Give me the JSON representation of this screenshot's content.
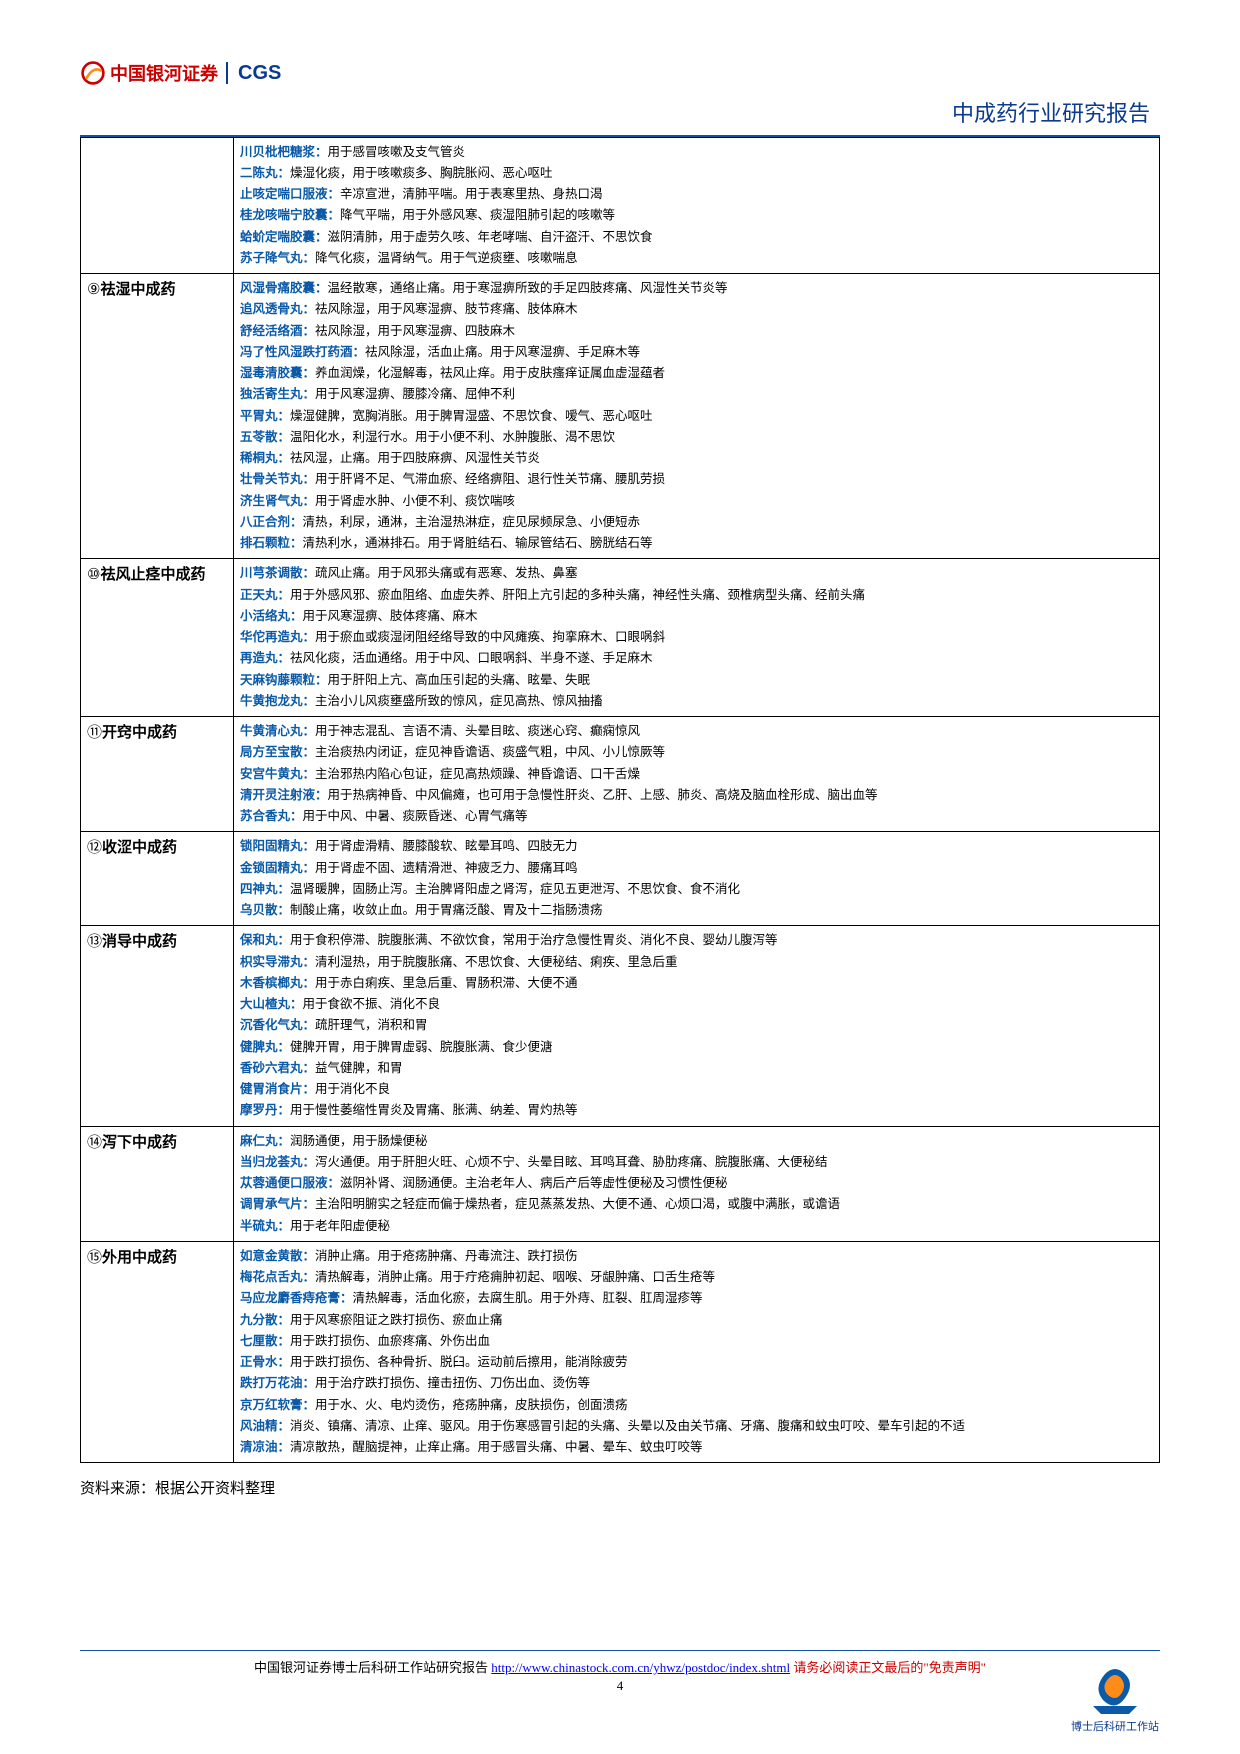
{
  "header": {
    "logo_cn": "中国银河证券",
    "logo_en": "CGS",
    "report_title": "中成药行业研究报告"
  },
  "sections": [
    {
      "id": "s0",
      "cat_circ": "",
      "cat_name": "",
      "show_cat": false,
      "items": [
        {
          "name": "川贝枇杷糖浆：",
          "desc": "用于感冒咳嗽及支气管炎"
        },
        {
          "name": "二陈丸：",
          "desc": "燥湿化痰，用于咳嗽痰多、胸脘胀闷、恶心呕吐"
        },
        {
          "name": "止咳定喘口服液：",
          "desc": "辛凉宣泄，清肺平喘。用于表寒里热、身热口渴"
        },
        {
          "name": "桂龙咳喘宁胶囊：",
          "desc": "降气平喘，用于外感风寒、痰湿阻肺引起的咳嗽等"
        },
        {
          "name": "蛤蚧定喘胶囊：",
          "desc": "滋阴清肺，用于虚劳久咳、年老哮喘、自汗盗汗、不思饮食"
        },
        {
          "name": "苏子降气丸：",
          "desc": "降气化痰，温肾纳气。用于气逆痰壅、咳嗽喘息"
        }
      ]
    },
    {
      "id": "s9",
      "cat_circ": "⑨",
      "cat_name": "祛湿中成药",
      "show_cat": true,
      "items": [
        {
          "name": "风湿骨痛胶囊：",
          "desc": "温经散寒，通络止痛。用于寒湿痹所致的手足四肢疼痛、风湿性关节炎等"
        },
        {
          "name": "追风透骨丸：",
          "desc": "祛风除湿，用于风寒湿痹、肢节疼痛、肢体麻木"
        },
        {
          "name": "舒经活络酒：",
          "desc": "祛风除湿，用于风寒湿痹、四肢麻木"
        },
        {
          "name": "冯了性风湿跌打药酒：",
          "desc": "祛风除湿，活血止痛。用于风寒湿痹、手足麻木等"
        },
        {
          "name": "湿毒清胶囊：",
          "desc": "养血润燥，化湿解毒，祛风止痒。用于皮肤瘙痒证属血虚湿蕴者"
        },
        {
          "name": "独活寄生丸：",
          "desc": "用于风寒湿痹、腰膝冷痛、屈伸不利"
        },
        {
          "name": "平胃丸：",
          "desc": "燥湿健脾，宽胸消胀。用于脾胃湿盛、不思饮食、嗳气、恶心呕吐"
        },
        {
          "name": "五苓散：",
          "desc": "温阳化水，利湿行水。用于小便不利、水肿腹胀、渴不思饮"
        },
        {
          "name": "稀桐丸：",
          "desc": "祛风湿，止痛。用于四肢麻痹、风湿性关节炎"
        },
        {
          "name": "壮骨关节丸：",
          "desc": "用于肝肾不足、气滞血瘀、经络痹阻、退行性关节痛、腰肌劳损"
        },
        {
          "name": "济生肾气丸：",
          "desc": "用于肾虚水肿、小便不利、痰饮喘咳"
        },
        {
          "name": "八正合剂：",
          "desc": "清热，利尿，通淋，主治湿热淋症，症见尿频尿急、小便短赤"
        },
        {
          "name": "排石颗粒：",
          "desc": "清热利水，通淋排石。用于肾脏结石、输尿管结石、膀胱结石等"
        }
      ]
    },
    {
      "id": "s10",
      "cat_circ": "⑩",
      "cat_name": "祛风止痉中成药",
      "show_cat": true,
      "items": [
        {
          "name": "川芎茶调散：",
          "desc": "疏风止痛。用于风邪头痛或有恶寒、发热、鼻塞"
        },
        {
          "name": "正天丸：",
          "desc": "用于外感风邪、瘀血阻络、血虚失养、肝阳上亢引起的多种头痛，神经性头痛、颈椎病型头痛、经前头痛"
        },
        {
          "name": "小活络丸：",
          "desc": "用于风寒湿痹、肢体疼痛、麻木"
        },
        {
          "name": "华佗再造丸：",
          "desc": "用于瘀血或痰湿闭阻经络导致的中风瘫痪、拘挛麻木、口眼㖞斜"
        },
        {
          "name": "再造丸：",
          "desc": "祛风化痰，活血通络。用于中风、口眼㖞斜、半身不遂、手足麻木"
        },
        {
          "name": "天麻钩藤颗粒：",
          "desc": "用于肝阳上亢、高血压引起的头痛、眩晕、失眠"
        },
        {
          "name": "牛黄抱龙丸：",
          "desc": "主治小儿风痰壅盛所致的惊风，症见高热、惊风抽搐"
        }
      ]
    },
    {
      "id": "s11",
      "cat_circ": "⑪",
      "cat_name": "开窍中成药",
      "show_cat": true,
      "items": [
        {
          "name": "牛黄清心丸：",
          "desc": "用于神志混乱、言语不清、头晕目眩、痰迷心窍、癫痫惊风"
        },
        {
          "name": "局方至宝散：",
          "desc": "主治痰热内闭证，症见神昏谵语、痰盛气粗，中风、小儿惊厥等"
        },
        {
          "name": "安宫牛黄丸：",
          "desc": "主治邪热内陷心包证，症见高热烦躁、神昏谵语、口干舌燥"
        },
        {
          "name": "清开灵注射液：",
          "desc": "用于热病神昏、中风偏瘫，也可用于急慢性肝炎、乙肝、上感、肺炎、高烧及脑血栓形成、脑出血等"
        },
        {
          "name": "苏合香丸：",
          "desc": "用于中风、中暑、痰厥昏迷、心胃气痛等"
        }
      ]
    },
    {
      "id": "s12",
      "cat_circ": "⑫",
      "cat_name": "收涩中成药",
      "show_cat": true,
      "items": [
        {
          "name": "锁阳固精丸：",
          "desc": "用于肾虚滑精、腰膝酸软、眩晕耳鸣、四肢无力"
        },
        {
          "name": "金锁固精丸：",
          "desc": "用于肾虚不固、遗精滑泄、神疲乏力、腰痛耳鸣"
        },
        {
          "name": "四神丸：",
          "desc": "温肾暖脾，固肠止泻。主治脾肾阳虚之肾泻，症见五更泄泻、不思饮食、食不消化"
        },
        {
          "name": "乌贝散：",
          "desc": "制酸止痛，收敛止血。用于胃痛泛酸、胃及十二指肠溃疡"
        }
      ]
    },
    {
      "id": "s13",
      "cat_circ": "⑬",
      "cat_name": "消导中成药",
      "show_cat": true,
      "items": [
        {
          "name": "保和丸：",
          "desc": "用于食积停滞、脘腹胀满、不欲饮食，常用于治疗急慢性胃炎、消化不良、婴幼儿腹泻等"
        },
        {
          "name": "枳实导滞丸：",
          "desc": "清利湿热，用于脘腹胀痛、不思饮食、大便秘结、痢疾、里急后重"
        },
        {
          "name": "木香槟榔丸：",
          "desc": "用于赤白痢疾、里急后重、胃肠积滞、大便不通"
        },
        {
          "name": "大山楂丸：",
          "desc": "用于食欲不振、消化不良"
        },
        {
          "name": "沉香化气丸：",
          "desc": "疏肝理气，消积和胃"
        },
        {
          "name": "健脾丸：",
          "desc": "健脾开胃，用于脾胃虚弱、脘腹胀满、食少便溏"
        },
        {
          "name": "香砂六君丸：",
          "desc": "益气健脾，和胃"
        },
        {
          "name": "健胃消食片：",
          "desc": "用于消化不良"
        },
        {
          "name": "摩罗丹：",
          "desc": "用于慢性萎缩性胃炎及胃痛、胀满、纳差、胃灼热等"
        }
      ]
    },
    {
      "id": "s14",
      "cat_circ": "⑭",
      "cat_name": "泻下中成药",
      "show_cat": true,
      "items": [
        {
          "name": "麻仁丸：",
          "desc": "润肠通便，用于肠燥便秘"
        },
        {
          "name": "当归龙荟丸：",
          "desc": "泻火通便。用于肝胆火旺、心烦不宁、头晕目眩、耳鸣耳聋、胁肋疼痛、脘腹胀痛、大便秘结"
        },
        {
          "name": "苁蓉通便口服液：",
          "desc": "滋阴补肾、润肠通便。主治老年人、病后产后等虚性便秘及习惯性便秘"
        },
        {
          "name": "调胃承气片：",
          "desc": "主治阳明腑实之轻症而偏于燥热者，症见蒸蒸发热、大便不通、心烦口渴，或腹中满胀，或谵语"
        },
        {
          "name": "半硫丸：",
          "desc": "用于老年阳虚便秘"
        }
      ]
    },
    {
      "id": "s15",
      "cat_circ": "⑮",
      "cat_name": "外用中成药",
      "show_cat": true,
      "items": [
        {
          "name": "如意金黄散：",
          "desc": "消肿止痛。用于疮疡肿痛、丹毒流注、跌打损伤"
        },
        {
          "name": "梅花点舌丸：",
          "desc": "清热解毒，消肿止痛。用于疔疮痈肿初起、咽喉、牙龈肿痛、口舌生疮等"
        },
        {
          "name": "马应龙麝香痔疮膏：",
          "desc": "清热解毒，活血化瘀，去腐生肌。用于外痔、肛裂、肛周湿疹等"
        },
        {
          "name": "九分散：",
          "desc": "用于风寒瘀阻证之跌打损伤、瘀血止痛"
        },
        {
          "name": "七厘散：",
          "desc": "用于跌打损伤、血瘀疼痛、外伤出血"
        },
        {
          "name": "正骨水：",
          "desc": "用于跌打损伤、各种骨折、脱臼。运动前后擦用，能消除疲劳"
        },
        {
          "name": "跌打万花油：",
          "desc": "用于治疗跌打损伤、撞击扭伤、刀伤出血、烫伤等"
        },
        {
          "name": "京万红软膏：",
          "desc": "用于水、火、电灼烫伤，疮疡肿痛，皮肤损伤，创面溃疡"
        },
        {
          "name": "风油精：",
          "desc": "消炎、镇痛、清凉、止痒、驱风。用于伤寒感冒引起的头痛、头晕以及由关节痛、牙痛、腹痛和蚊虫叮咬、晕车引起的不适"
        },
        {
          "name": "清凉油：",
          "desc": "清凉散热，醒脑提神，止痒止痛。用于感冒头痛、中暑、晕车、蚊虫叮咬等"
        }
      ]
    }
  ],
  "source_line": "资料来源：根据公开资料整理",
  "footer": {
    "prefix": "中国银河证券博士后科研工作站研究报告 ",
    "link": "http://www.chinastock.com.cn/yhwz/postdoc/index.shtml",
    "suffix_red": "  请务必阅读正文最后的\"免责声明\"",
    "page_num": "4",
    "badge": "博士后科研工作站"
  }
}
